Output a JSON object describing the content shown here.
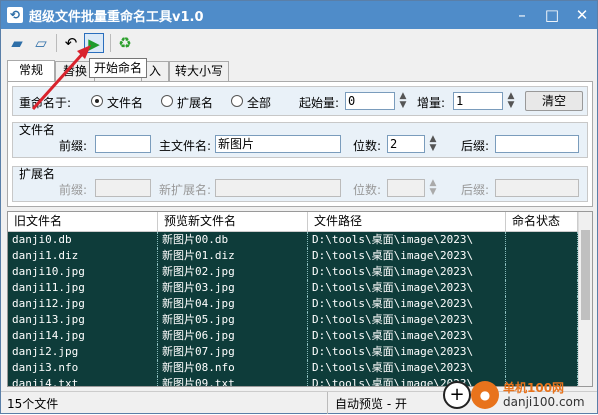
{
  "window": {
    "title": "超级文件批量重命名工具v1.0"
  },
  "tooltip": "开始命名",
  "tabs": [
    "常规",
    "替换",
    "入",
    "转大小写"
  ],
  "mode": {
    "label": "重命名于:",
    "options": [
      "文件名",
      "扩展名",
      "全部"
    ],
    "start_label": "起始量:",
    "start_value": "0",
    "inc_label": "增量:",
    "inc_value": "1",
    "clear_label": "清空"
  },
  "filename": {
    "legend": "文件名",
    "prefix_label": "前缀:",
    "prefix_value": "",
    "main_label": "主文件名:",
    "main_value": "新图片",
    "digits_label": "位数:",
    "digits_value": "2",
    "suffix_label": "后缀:",
    "suffix_value": ""
  },
  "extension": {
    "legend": "扩展名",
    "prefix_label": "前缀:",
    "main_label": "新扩展名:",
    "digits_label": "位数:",
    "suffix_label": "后缀:"
  },
  "table": {
    "columns": [
      "旧文件名",
      "预览新文件名",
      "文件路径",
      "命名状态"
    ],
    "rows": [
      {
        "old": "danji0.db",
        "new": "新图片00.db",
        "path": "D:\\tools\\桌面\\image\\2023\\",
        "status": ""
      },
      {
        "old": "danji1.diz",
        "new": "新图片01.diz",
        "path": "D:\\tools\\桌面\\image\\2023\\",
        "status": ""
      },
      {
        "old": "danji10.jpg",
        "new": "新图片02.jpg",
        "path": "D:\\tools\\桌面\\image\\2023\\",
        "status": ""
      },
      {
        "old": "danji11.jpg",
        "new": "新图片03.jpg",
        "path": "D:\\tools\\桌面\\image\\2023\\",
        "status": ""
      },
      {
        "old": "danji12.jpg",
        "new": "新图片04.jpg",
        "path": "D:\\tools\\桌面\\image\\2023\\",
        "status": ""
      },
      {
        "old": "danji13.jpg",
        "new": "新图片05.jpg",
        "path": "D:\\tools\\桌面\\image\\2023\\",
        "status": ""
      },
      {
        "old": "danji14.jpg",
        "new": "新图片06.jpg",
        "path": "D:\\tools\\桌面\\image\\2023\\",
        "status": ""
      },
      {
        "old": "danji2.jpg",
        "new": "新图片07.jpg",
        "path": "D:\\tools\\桌面\\image\\2023\\",
        "status": ""
      },
      {
        "old": "danji3.nfo",
        "new": "新图片08.nfo",
        "path": "D:\\tools\\桌面\\image\\2023\\",
        "status": ""
      },
      {
        "old": "danji4.txt",
        "new": "新图片09.txt",
        "path": "D:\\tools\\桌面\\image\\2023\\",
        "status": ""
      }
    ]
  },
  "status": {
    "count": "15个文件",
    "preview": "自动预览 - 开"
  },
  "watermark": {
    "line1": "单机100网",
    "line2": "danji100.com"
  },
  "colors": {
    "titlebar": "#4f8cc9",
    "row_bg": "#0e3c3a",
    "panel_bg": "#e9f1f8",
    "arrow": "#d9232d"
  }
}
